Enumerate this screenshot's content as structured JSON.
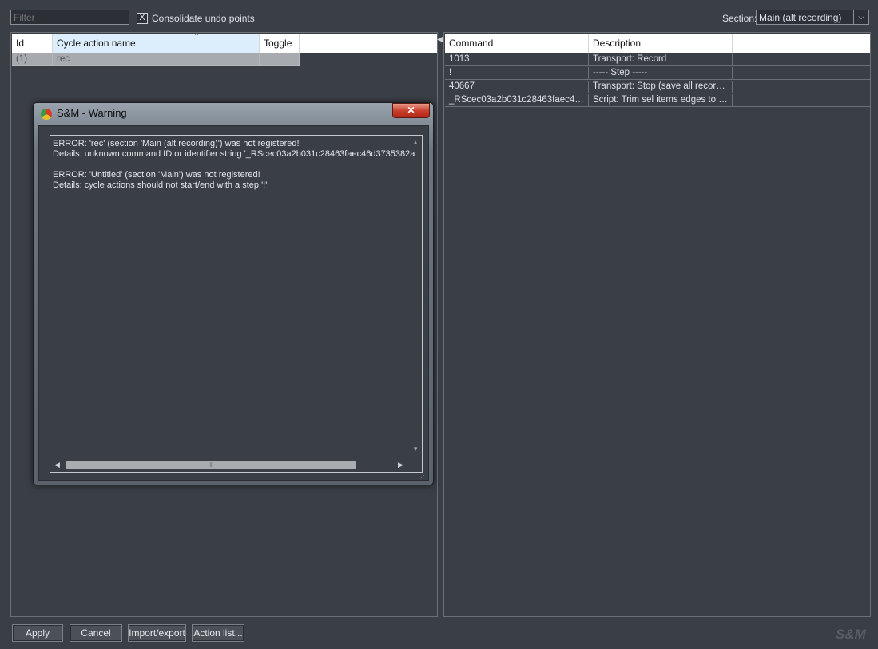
{
  "toolbar": {
    "filter_placeholder": "Filter",
    "consolidate_label": "Consolidate undo points",
    "consolidate_checked": true,
    "consolidate_mark": "X",
    "section_label": "Section:",
    "section_value": "Main (alt recording)",
    "select_arrow": "⌵"
  },
  "cycle_table": {
    "columns": [
      "Id",
      "Cycle action name",
      "Toggle"
    ],
    "rows": [
      {
        "id": "(1)",
        "name": "rec",
        "toggle": ""
      }
    ]
  },
  "command_table": {
    "columns": [
      "Command",
      "Description"
    ],
    "rows": [
      {
        "command": "1013",
        "description": "Transport: Record"
      },
      {
        "command": "!",
        "description": "----- Step -----"
      },
      {
        "command": "40667",
        "description": "Transport: Stop (save all record…"
      },
      {
        "command": "_RScec03a2b031c28463faec46d…",
        "description": "Script: Trim sel items edges to n…"
      }
    ]
  },
  "buttons": {
    "apply": "Apply",
    "cancel": "Cancel",
    "import_export": "Import/export",
    "action_list": "Action list..."
  },
  "brand": "S&M",
  "dialog": {
    "title": "S&M - Warning",
    "close_glyph": "✕",
    "lines": [
      "ERROR: 'rec' (section 'Main (alt recording)') was not registered!",
      "Details: unknown command ID or identifier string '_RScec03a2b031c28463faec46d3735382a",
      "ERROR: 'Untitled' (section 'Main') was not registered!",
      "Details: cycle actions should not start/end with a step '!'"
    ],
    "scroll_up": "▲",
    "scroll_down": "▼",
    "scroll_left": "◀",
    "scroll_right": "▶",
    "thumb_grip": "III",
    "resize_grip": "⋰"
  },
  "colors": {
    "background": "#3a3f46",
    "header_background": "#ffffff",
    "selected_row": "#a7aaaf",
    "close_button": "#c9402e"
  }
}
